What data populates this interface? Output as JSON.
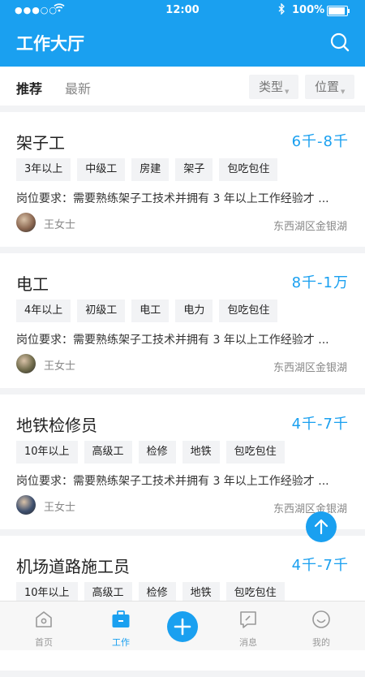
{
  "status_bar": {
    "signal": "●●●○○",
    "time": "12:00",
    "battery": "100%",
    "battery_level": 1.0
  },
  "header": {
    "title": "工作大厅"
  },
  "filters": {
    "tabs": [
      "推荐",
      "最新"
    ],
    "type_label": "类型",
    "location_label": "位置"
  },
  "jobs": [
    {
      "title": "架子工",
      "salary": "6千-8千",
      "tags": [
        "3年以上",
        "中级工",
        "房建",
        "架子",
        "包吃包住"
      ],
      "requirement": "岗位要求：需要熟练架子工技术并拥有 3 年以上工作经验才 ...",
      "poster": "王女士",
      "location": "东西湖区金银湖",
      "avatar_color": "#8a6650"
    },
    {
      "title": "电工",
      "salary": "8千-1万",
      "tags": [
        "4年以上",
        "初级工",
        "电工",
        "电力",
        "包吃包住"
      ],
      "requirement": "岗位要求：需要熟练架子工技术并拥有 3 年以上工作经验才 ...",
      "poster": "王女士",
      "location": "东西湖区金银湖",
      "avatar_color": "#6e6a4a"
    },
    {
      "title": "地铁检修员",
      "salary": "4千-7千",
      "tags": [
        "10年以上",
        "高级工",
        "检修",
        "地铁",
        "包吃包住"
      ],
      "requirement": "岗位要求：需要熟练架子工技术并拥有 3 年以上工作经验才 ...",
      "poster": "王女士",
      "location": "东西湖区金银湖",
      "avatar_color": "#3d4f6e"
    },
    {
      "title": "机场道路施工员",
      "salary": "4千-7千",
      "tags": [
        "10年以上",
        "高级工",
        "检修",
        "地铁",
        "包吃包住"
      ],
      "requirement": "",
      "poster": "",
      "location": "",
      "avatar_color": "#ffffff"
    }
  ],
  "tabbar": {
    "home": "首页",
    "work": "工作",
    "messages": "消息",
    "mine": "我的"
  },
  "colors": {
    "accent": "#1aa0f0",
    "background": "#f2f3f5"
  },
  "icons": [
    "search-icon",
    "back-to-top-icon",
    "plus-icon",
    "home-icon",
    "briefcase-icon",
    "message-icon",
    "smiley-icon",
    "wifi-icon",
    "bluetooth-icon"
  ]
}
